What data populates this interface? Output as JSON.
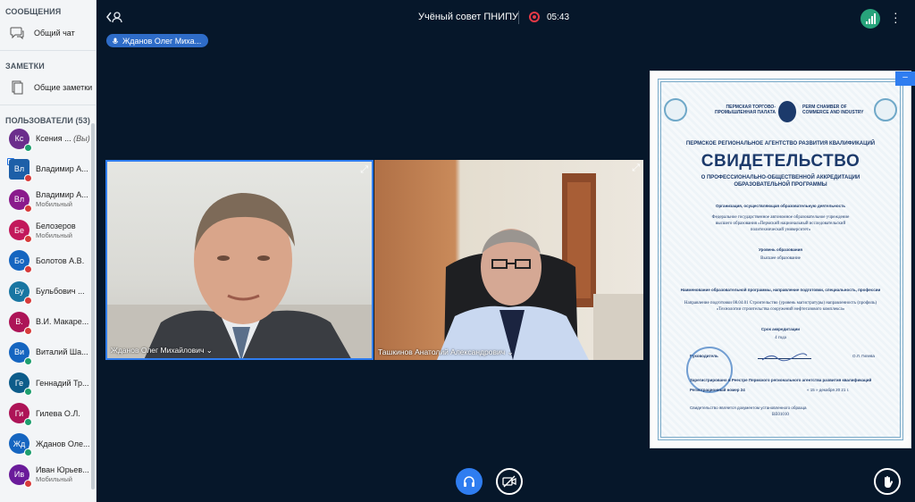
{
  "sidebar": {
    "messages_title": "СООБЩЕНИЯ",
    "public_chat": "Общий чат",
    "notes_title": "ЗАМЕТКИ",
    "shared_notes": "Общие заметки",
    "users_title": "ПОЛЬЗОВАТЕЛИ (53)",
    "users": [
      {
        "initials": "Кс",
        "name": "Ксения ...",
        "suffix": "(Вы)",
        "sub": "",
        "color": "#6b2d8c",
        "mic": "g"
      },
      {
        "initials": "Вл",
        "name": "Владимир А...",
        "suffix": "",
        "sub": "",
        "color": "#1d5fa8",
        "mic": "r",
        "presenter": true
      },
      {
        "initials": "Вл",
        "name": "Владимир А...",
        "suffix": "",
        "sub": "Мобильный",
        "color": "#8a1a8c",
        "mic": "r"
      },
      {
        "initials": "Бе",
        "name": "Белозеров",
        "suffix": "",
        "sub": "Мобильный",
        "color": "#c2185b",
        "mic": "r"
      },
      {
        "initials": "Бо",
        "name": "Болотов А.В.",
        "suffix": "",
        "sub": "",
        "color": "#1565c0",
        "mic": "r"
      },
      {
        "initials": "Бу",
        "name": "Бульбович ...",
        "suffix": "",
        "sub": "",
        "color": "#1976a2",
        "mic": "r"
      },
      {
        "initials": "В.",
        "name": "В.И. Макаре...",
        "suffix": "",
        "sub": "",
        "color": "#ad1457",
        "mic": "r"
      },
      {
        "initials": "Ви",
        "name": "Виталий Ша...",
        "suffix": "",
        "sub": "",
        "color": "#1565c0",
        "mic": "g"
      },
      {
        "initials": "Ге",
        "name": "Геннадий Тр...",
        "suffix": "",
        "sub": "",
        "color": "#0d5c8a",
        "mic": "g"
      },
      {
        "initials": "Ги",
        "name": "Гилева О.Л.",
        "suffix": "",
        "sub": "",
        "color": "#ad1457",
        "mic": "g"
      },
      {
        "initials": "Жд",
        "name": "Жданов Оле...",
        "suffix": "",
        "sub": "",
        "color": "#1565c0",
        "mic": "g"
      },
      {
        "initials": "Ив",
        "name": "Иван Юрьев...",
        "suffix": "",
        "sub": "Мобильный",
        "color": "#6a1b9a",
        "mic": "r"
      }
    ]
  },
  "header": {
    "title": "Учёный совет ПНИПУ",
    "timer": "05:43",
    "talking": "Жданов Олег Миха..."
  },
  "videos": [
    {
      "name": "Жданов Олег Михайлович ⌄"
    },
    {
      "name": "Ташкинов Анатолий Александрович ⌄"
    }
  ],
  "document": {
    "chamber_ru": "ПЕРМСКАЯ ТОРГОВО-ПРОМЫШЛЕННАЯ ПАЛАТА",
    "chamber_en": "PERM CHAMBER OF COMMERCE AND INDUSTRY",
    "agency": "ПЕРМСКОЕ РЕГИОНАЛЬНОЕ АГЕНТСТВО РАЗВИТИЯ КВАЛИФИКАЦИЙ",
    "title": "СВИДЕТЕЛЬСТВО",
    "subtitle": "О ПРОФЕССИОНАЛЬНО-ОБЩЕСТВЕННОЙ АККРЕДИТАЦИИ ОБРАЗОВАТЕЛЬНОЙ ПРОГРАММЫ",
    "org_label": "Организация, осуществляющая образовательную деятельность",
    "org_text": "Федеральное государственное автономное образовательное учреждение высшего образования «Пермский национальный исследовательский политехнический университет»",
    "level_label": "Уровень образования",
    "level_text": "Высшее образование",
    "program_label": "Наименование образовательной программы, направление подготовки, специальность, профессии",
    "program_text": "Направление подготовки 08.04.01 Строительство (уровень магистратуры) направленность (профиль) «Технологии строительства сооружений нефтегазового комплекса»",
    "term_label": "Срок аккредитации",
    "term_text": "4 года",
    "head_label": "Руководитель",
    "head_name": "О.Л. Гилева",
    "reg_label": "Зарегистрировано в Реестре Пермского регионального агентства развития квалификаций",
    "reg_number": "Регистрационный номер  24",
    "reg_date": "« 15 »  декабря  20 21 г.",
    "doc_note": "Свидетельство является документом установленного образца",
    "serial": "ВЕ01010"
  }
}
